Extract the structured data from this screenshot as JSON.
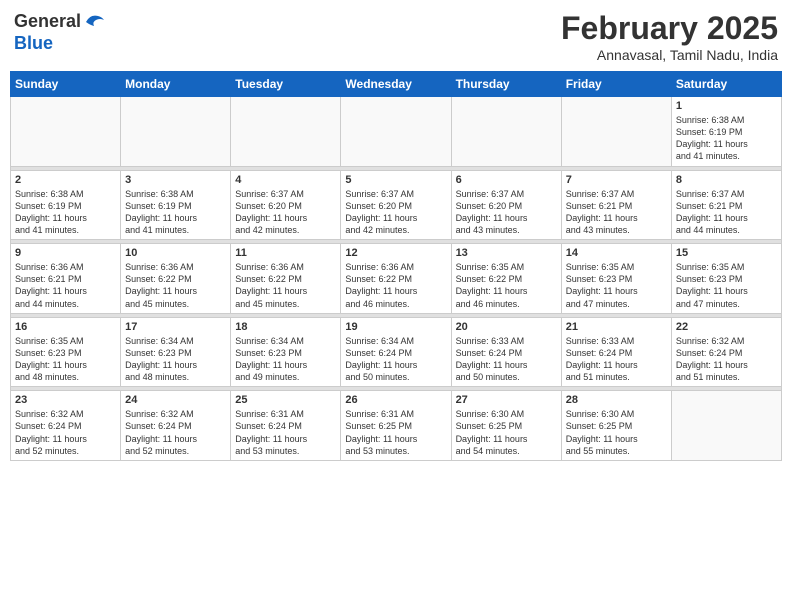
{
  "header": {
    "logo": {
      "line1": "General",
      "line2": "Blue"
    },
    "title": "February 2025",
    "subtitle": "Annavasal, Tamil Nadu, India"
  },
  "calendar": {
    "weekdays": [
      "Sunday",
      "Monday",
      "Tuesday",
      "Wednesday",
      "Thursday",
      "Friday",
      "Saturday"
    ],
    "weeks": [
      [
        {
          "day": "",
          "info": ""
        },
        {
          "day": "",
          "info": ""
        },
        {
          "day": "",
          "info": ""
        },
        {
          "day": "",
          "info": ""
        },
        {
          "day": "",
          "info": ""
        },
        {
          "day": "",
          "info": ""
        },
        {
          "day": "1",
          "info": "Sunrise: 6:38 AM\nSunset: 6:19 PM\nDaylight: 11 hours\nand 41 minutes."
        }
      ],
      [
        {
          "day": "2",
          "info": "Sunrise: 6:38 AM\nSunset: 6:19 PM\nDaylight: 11 hours\nand 41 minutes."
        },
        {
          "day": "3",
          "info": "Sunrise: 6:38 AM\nSunset: 6:19 PM\nDaylight: 11 hours\nand 41 minutes."
        },
        {
          "day": "4",
          "info": "Sunrise: 6:37 AM\nSunset: 6:20 PM\nDaylight: 11 hours\nand 42 minutes."
        },
        {
          "day": "5",
          "info": "Sunrise: 6:37 AM\nSunset: 6:20 PM\nDaylight: 11 hours\nand 42 minutes."
        },
        {
          "day": "6",
          "info": "Sunrise: 6:37 AM\nSunset: 6:20 PM\nDaylight: 11 hours\nand 43 minutes."
        },
        {
          "day": "7",
          "info": "Sunrise: 6:37 AM\nSunset: 6:21 PM\nDaylight: 11 hours\nand 43 minutes."
        },
        {
          "day": "8",
          "info": "Sunrise: 6:37 AM\nSunset: 6:21 PM\nDaylight: 11 hours\nand 44 minutes."
        }
      ],
      [
        {
          "day": "9",
          "info": "Sunrise: 6:36 AM\nSunset: 6:21 PM\nDaylight: 11 hours\nand 44 minutes."
        },
        {
          "day": "10",
          "info": "Sunrise: 6:36 AM\nSunset: 6:22 PM\nDaylight: 11 hours\nand 45 minutes."
        },
        {
          "day": "11",
          "info": "Sunrise: 6:36 AM\nSunset: 6:22 PM\nDaylight: 11 hours\nand 45 minutes."
        },
        {
          "day": "12",
          "info": "Sunrise: 6:36 AM\nSunset: 6:22 PM\nDaylight: 11 hours\nand 46 minutes."
        },
        {
          "day": "13",
          "info": "Sunrise: 6:35 AM\nSunset: 6:22 PM\nDaylight: 11 hours\nand 46 minutes."
        },
        {
          "day": "14",
          "info": "Sunrise: 6:35 AM\nSunset: 6:23 PM\nDaylight: 11 hours\nand 47 minutes."
        },
        {
          "day": "15",
          "info": "Sunrise: 6:35 AM\nSunset: 6:23 PM\nDaylight: 11 hours\nand 47 minutes."
        }
      ],
      [
        {
          "day": "16",
          "info": "Sunrise: 6:35 AM\nSunset: 6:23 PM\nDaylight: 11 hours\nand 48 minutes."
        },
        {
          "day": "17",
          "info": "Sunrise: 6:34 AM\nSunset: 6:23 PM\nDaylight: 11 hours\nand 48 minutes."
        },
        {
          "day": "18",
          "info": "Sunrise: 6:34 AM\nSunset: 6:23 PM\nDaylight: 11 hours\nand 49 minutes."
        },
        {
          "day": "19",
          "info": "Sunrise: 6:34 AM\nSunset: 6:24 PM\nDaylight: 11 hours\nand 50 minutes."
        },
        {
          "day": "20",
          "info": "Sunrise: 6:33 AM\nSunset: 6:24 PM\nDaylight: 11 hours\nand 50 minutes."
        },
        {
          "day": "21",
          "info": "Sunrise: 6:33 AM\nSunset: 6:24 PM\nDaylight: 11 hours\nand 51 minutes."
        },
        {
          "day": "22",
          "info": "Sunrise: 6:32 AM\nSunset: 6:24 PM\nDaylight: 11 hours\nand 51 minutes."
        }
      ],
      [
        {
          "day": "23",
          "info": "Sunrise: 6:32 AM\nSunset: 6:24 PM\nDaylight: 11 hours\nand 52 minutes."
        },
        {
          "day": "24",
          "info": "Sunrise: 6:32 AM\nSunset: 6:24 PM\nDaylight: 11 hours\nand 52 minutes."
        },
        {
          "day": "25",
          "info": "Sunrise: 6:31 AM\nSunset: 6:24 PM\nDaylight: 11 hours\nand 53 minutes."
        },
        {
          "day": "26",
          "info": "Sunrise: 6:31 AM\nSunset: 6:25 PM\nDaylight: 11 hours\nand 53 minutes."
        },
        {
          "day": "27",
          "info": "Sunrise: 6:30 AM\nSunset: 6:25 PM\nDaylight: 11 hours\nand 54 minutes."
        },
        {
          "day": "28",
          "info": "Sunrise: 6:30 AM\nSunset: 6:25 PM\nDaylight: 11 hours\nand 55 minutes."
        },
        {
          "day": "",
          "info": ""
        }
      ]
    ]
  }
}
